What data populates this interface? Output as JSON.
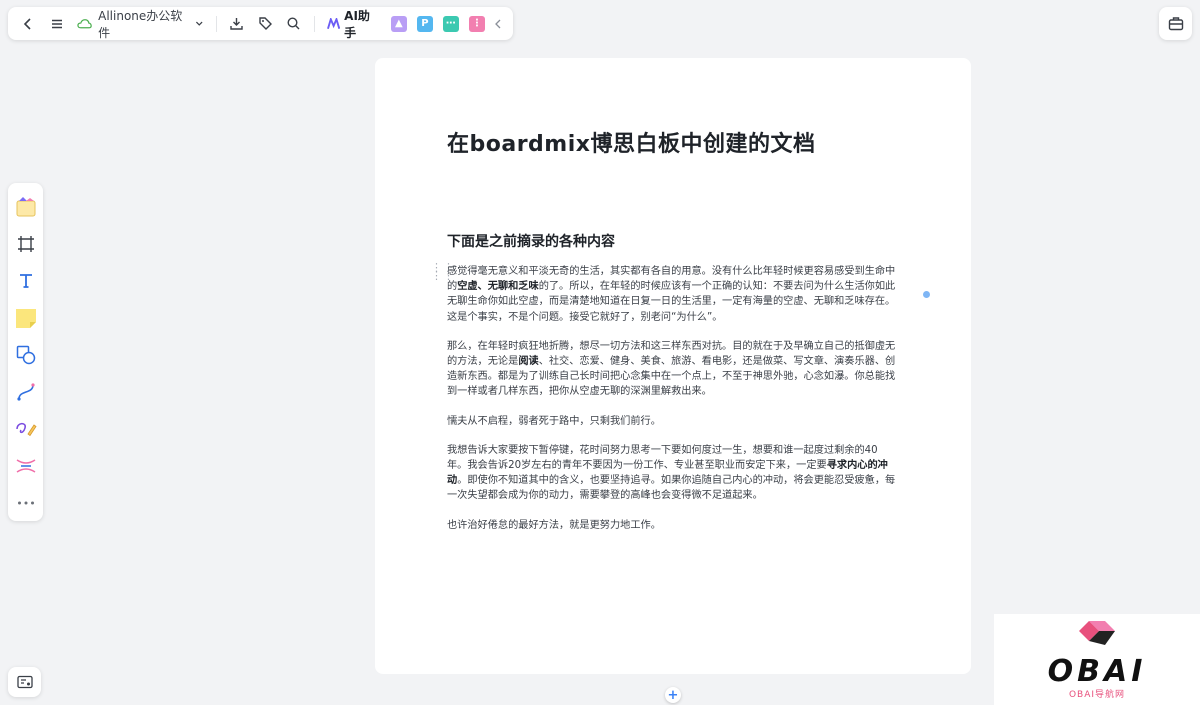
{
  "toolbar": {
    "file_name": "Allinone办公软件",
    "ai_label": "AI助手",
    "apps": [
      {
        "name": "image-app-icon",
        "color": "#b99ef5",
        "glyph": "▲"
      },
      {
        "name": "p-app-icon",
        "color": "#54b7f0",
        "glyph": "P"
      },
      {
        "name": "mindmap-app-icon",
        "color": "#3cc9b1",
        "glyph": "⋯"
      },
      {
        "name": "flow-app-icon",
        "color": "#f27fb0",
        "glyph": "⋮"
      }
    ]
  },
  "doc": {
    "title": "在boardmix博思白板中创建的文档",
    "subheading": "下面是之前摘录的各种内容",
    "p1_a": "感觉得毫无意义和平淡无奇的生活，其实都有各自的用意。没有什么比年轻时候更容易感受到生命中的",
    "p1_bold": "空虚、无聊和乏味",
    "p1_b": "的了。所以，在年轻的时候应该有一个正确的认知：不要去问为什么生活你如此无聊生命你如此空虚，而是清楚地知道在日复一日的生活里，一定有海量的空虚、无聊和乏味存在。这是个事实，不是个问题。接受它就好了，别老问“为什么”。",
    "p2_a": "那么，在年轻时疯狂地折腾，想尽一切方法和这三样东西对抗。目的就在于及早确立自己的抵御虚无的方法，无论是",
    "p2_bold": "阅读",
    "p2_b": "、社交、恋爱、健身、美食、旅游、看电影，还是做菜、写文章、演奏乐器、创造新东西。都是为了训练自己长时间把心念集中在一个点上，不至于神思外驰，心念如瀑。你总能找到一样或者几样东西，把你从空虚无聊的深渊里解救出来。",
    "p3": "懦夫从不启程，弱者死于路中，只剩我们前行。",
    "p4_a": "我想告诉大家要按下暂停键，花时间努力思考一下要如何度过一生，想要和谁一起度过剩余的40年。我会告诉20岁左右的青年不要因为一份工作、专业甚至职业而安定下来，一定要",
    "p4_bold": "寻求内心的冲动",
    "p4_b": "。即使你不知道其中的含义，也要坚持追寻。如果你追随自己内心的冲动，将会更能忍受疲惫，每一次失望都会成为你的动力，需要攀登的高峰也会变得微不足道起来。",
    "p5": "也许治好倦怠的最好方法，就是更努力地工作。"
  },
  "add_button": "+",
  "watermark": {
    "logo_text": "OBAI",
    "sub_text": "OBAI导航网"
  },
  "colors": {
    "accent": "#3b82f6",
    "page_bg": "#f2f3f5"
  }
}
